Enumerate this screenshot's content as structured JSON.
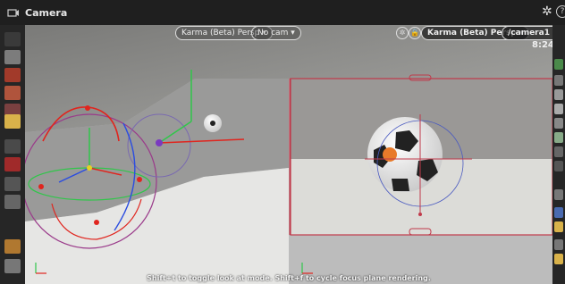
{
  "window": {
    "title": "Camera"
  },
  "left_view": {
    "renderer_label": "Karma (Beta)  Persp",
    "camera_label": "No cam"
  },
  "right_view": {
    "renderer_label": "Karma (Beta)  Persp",
    "camera_label": "/camera1",
    "frame": "8:24"
  },
  "status_message": "Shift+t to toggle look at mode. Shift+f to cycle focus plane rendering.",
  "colors": {
    "accent": "#d9b24a",
    "gizmo_red": "#e0251e",
    "gizmo_green": "#30c64a",
    "gizmo_blue": "#2b4de0",
    "frustum": "#c0394a"
  },
  "left_toolbar": {
    "icons": [
      "select-arrow-icon",
      "lock-icon",
      "sphere-icon",
      "paint-icon",
      "stack-icon",
      "highlighted-tool-icon",
      "view-icon",
      "magnet-icon",
      "snap-icon",
      "camera-icon",
      "ruler-icon",
      "pointer-icon"
    ]
  },
  "right_toolbar": {
    "icons": [
      "display-icon",
      "pin-icon",
      "light-icon",
      "light2-icon",
      "shade-icon",
      "wire-icon",
      "camera-view-icon",
      "grid-icon",
      "guides-icon",
      "ghost-icon",
      "bulb-icon",
      "options-icon"
    ]
  }
}
